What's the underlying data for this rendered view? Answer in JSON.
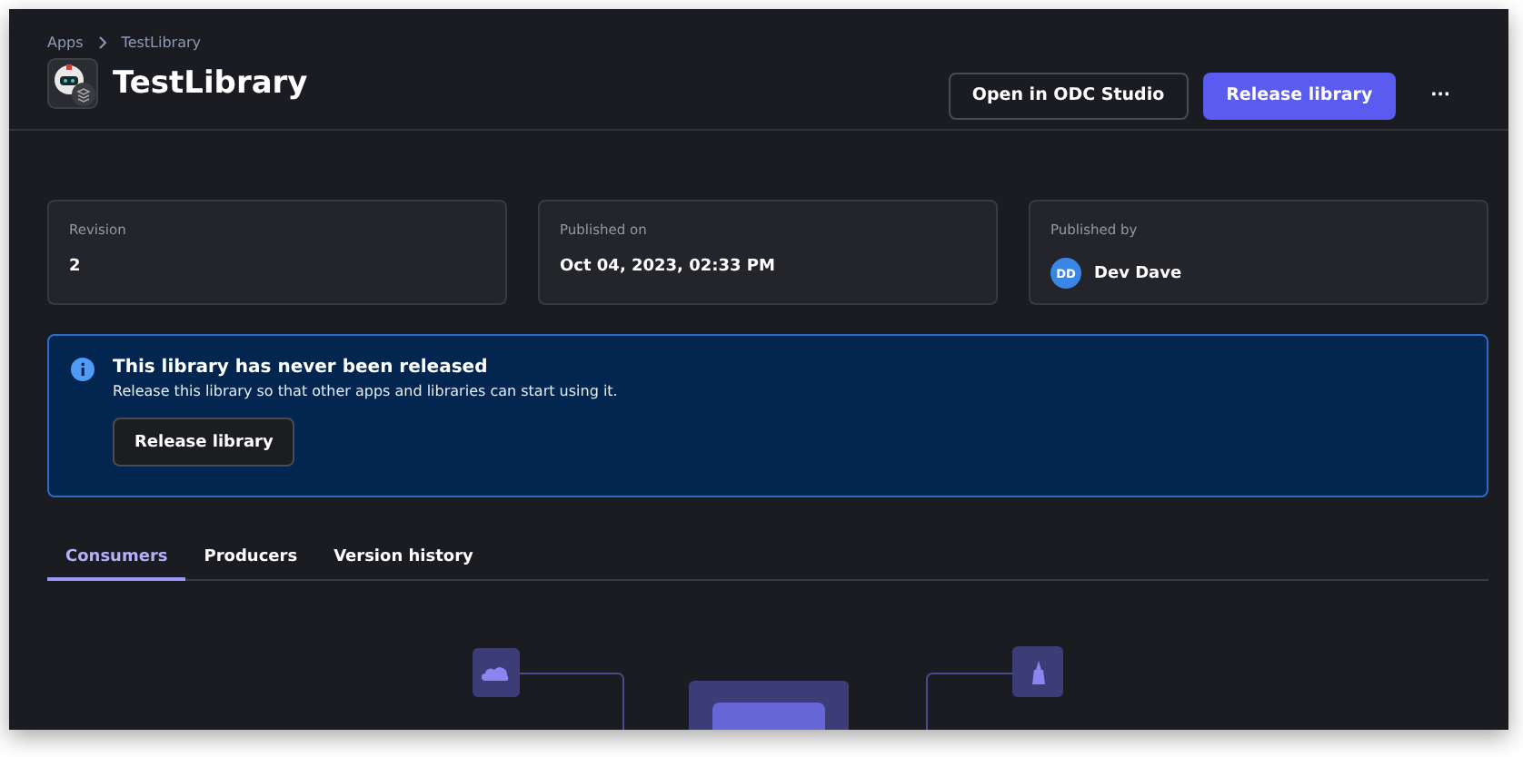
{
  "breadcrumb": [
    "Apps",
    "TestLibrary"
  ],
  "title": "TestLibrary",
  "actions": [
    {
      "label": "Open in ODC Studio",
      "kind": "secondary"
    },
    {
      "label": "Release library",
      "kind": "primary"
    },
    {
      "label": "···",
      "kind": "more"
    }
  ],
  "cards": [
    {
      "label": "Revision",
      "value": "2"
    },
    {
      "label": "Published on",
      "value": "Oct 04, 2023, 02:33 PM"
    },
    {
      "label": "Published by",
      "value": "Dev Dave",
      "avatar": "DD"
    }
  ],
  "banner": {
    "title": "This library has never been released",
    "text": "Release this library so that other apps and libraries can start using it.",
    "button": "Release library"
  },
  "tabs": [
    {
      "label": "Consumers",
      "selected": true
    },
    {
      "label": "Producers",
      "selected": false
    },
    {
      "label": "Version history",
      "selected": false
    }
  ]
}
